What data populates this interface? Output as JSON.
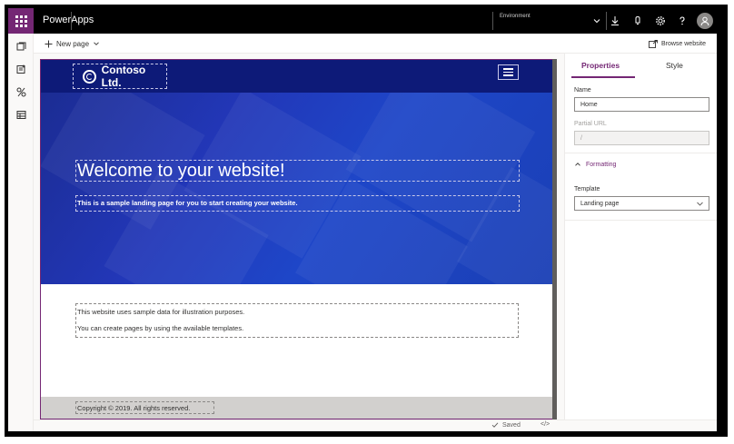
{
  "header": {
    "app_name": "PowerApps",
    "environment_label": "Environment"
  },
  "commandbar": {
    "new_page_label": "New page",
    "browse_label": "Browse website"
  },
  "site": {
    "logo_text": "Contoso Ltd.",
    "hero_title": "Welcome to your website!",
    "hero_subtitle": "This is a sample landing page for you to start creating your website.",
    "content_line1": "This website uses sample data for illustration purposes.",
    "content_line2": "You can create pages by using the available templates.",
    "footer_text": "Copyright © 2019. All rights reserved."
  },
  "panel": {
    "tabs": [
      {
        "label": "Properties",
        "active": true
      },
      {
        "label": "Style",
        "active": false
      }
    ],
    "name_label": "Name",
    "name_value": "Home",
    "partial_url_label": "Partial URL",
    "partial_url_value": "/",
    "formatting_label": "Formatting",
    "template_label": "Template",
    "template_value": "Landing page"
  },
  "status": {
    "saved_label": "Saved",
    "code_label": "</>"
  },
  "colors": {
    "accent": "#742774",
    "hero_dark": "#0d1a78",
    "hero": "#2237b8"
  },
  "icons": [
    "waffle-icon",
    "chevron-down-icon",
    "download-icon",
    "bell-icon",
    "gear-icon",
    "help-icon",
    "person-icon",
    "pages-icon",
    "components-icon",
    "themes-icon",
    "data-icon",
    "plus-icon",
    "browse-icon",
    "hamburger-icon",
    "check-icon",
    "code-icon"
  ]
}
